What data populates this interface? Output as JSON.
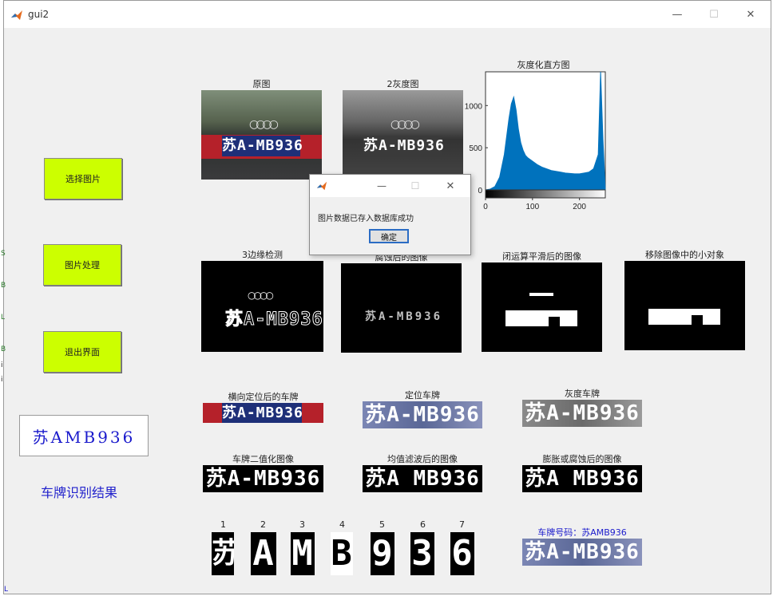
{
  "window": {
    "title": "gui2",
    "minimize": "—",
    "maximize": "☐",
    "close": "✕"
  },
  "buttons": {
    "select_image": "选择图片",
    "process_image": "图片处理",
    "exit": "退出界面"
  },
  "result": {
    "plate": "苏AMB936",
    "caption": "车牌识别结果"
  },
  "axes": {
    "original": "原图",
    "gray": "2灰度图",
    "histogram": "灰度化直方图",
    "edge": "3边缘检测",
    "eroded": "腐蚀后的图像",
    "closed": "闭运算平滑后的图像",
    "removed": "移除图像中的小对象",
    "h_located": "横向定位后的车牌",
    "located": "定位车牌",
    "gray_plate": "灰度车牌",
    "binary": "车牌二值化图像",
    "mean_filter": "均值滤波后的图像",
    "dilate": "膨胀或腐蚀后的图像",
    "plate_number": "车牌号码：苏AMB936"
  },
  "plate_text": "苏A-MB936",
  "plate_text_clean": "苏A MB936",
  "chars": [
    "苏",
    "A",
    "M",
    "B",
    "9",
    "3",
    "6"
  ],
  "char_numbers": [
    "1",
    "2",
    "3",
    "4",
    "5",
    "6",
    "7"
  ],
  "chart_data": {
    "type": "bar",
    "title": "灰度化直方图",
    "xlim": [
      0,
      255
    ],
    "ylim": [
      0,
      1400
    ],
    "xticks": [
      "0",
      "100",
      "200"
    ],
    "yticks": [
      "0",
      "500",
      "1000"
    ],
    "x": [
      0,
      10,
      20,
      30,
      40,
      50,
      55,
      60,
      65,
      70,
      75,
      80,
      85,
      90,
      95,
      100,
      110,
      120,
      130,
      140,
      150,
      160,
      170,
      180,
      190,
      200,
      210,
      220,
      230,
      240,
      245,
      250,
      255
    ],
    "values": [
      0,
      10,
      40,
      150,
      420,
      850,
      1020,
      1100,
      950,
      720,
      560,
      470,
      410,
      380,
      360,
      340,
      300,
      270,
      250,
      230,
      220,
      210,
      200,
      195,
      190,
      190,
      200,
      210,
      250,
      420,
      1400,
      600,
      0
    ],
    "color": "#0072bd"
  },
  "dialog": {
    "message": "图片数据已存入数据库成功",
    "ok": "确定"
  },
  "left_strip": [
    "S",
    "B",
    "L",
    "B",
    "i",
    "i"
  ],
  "bottom_link": "L"
}
